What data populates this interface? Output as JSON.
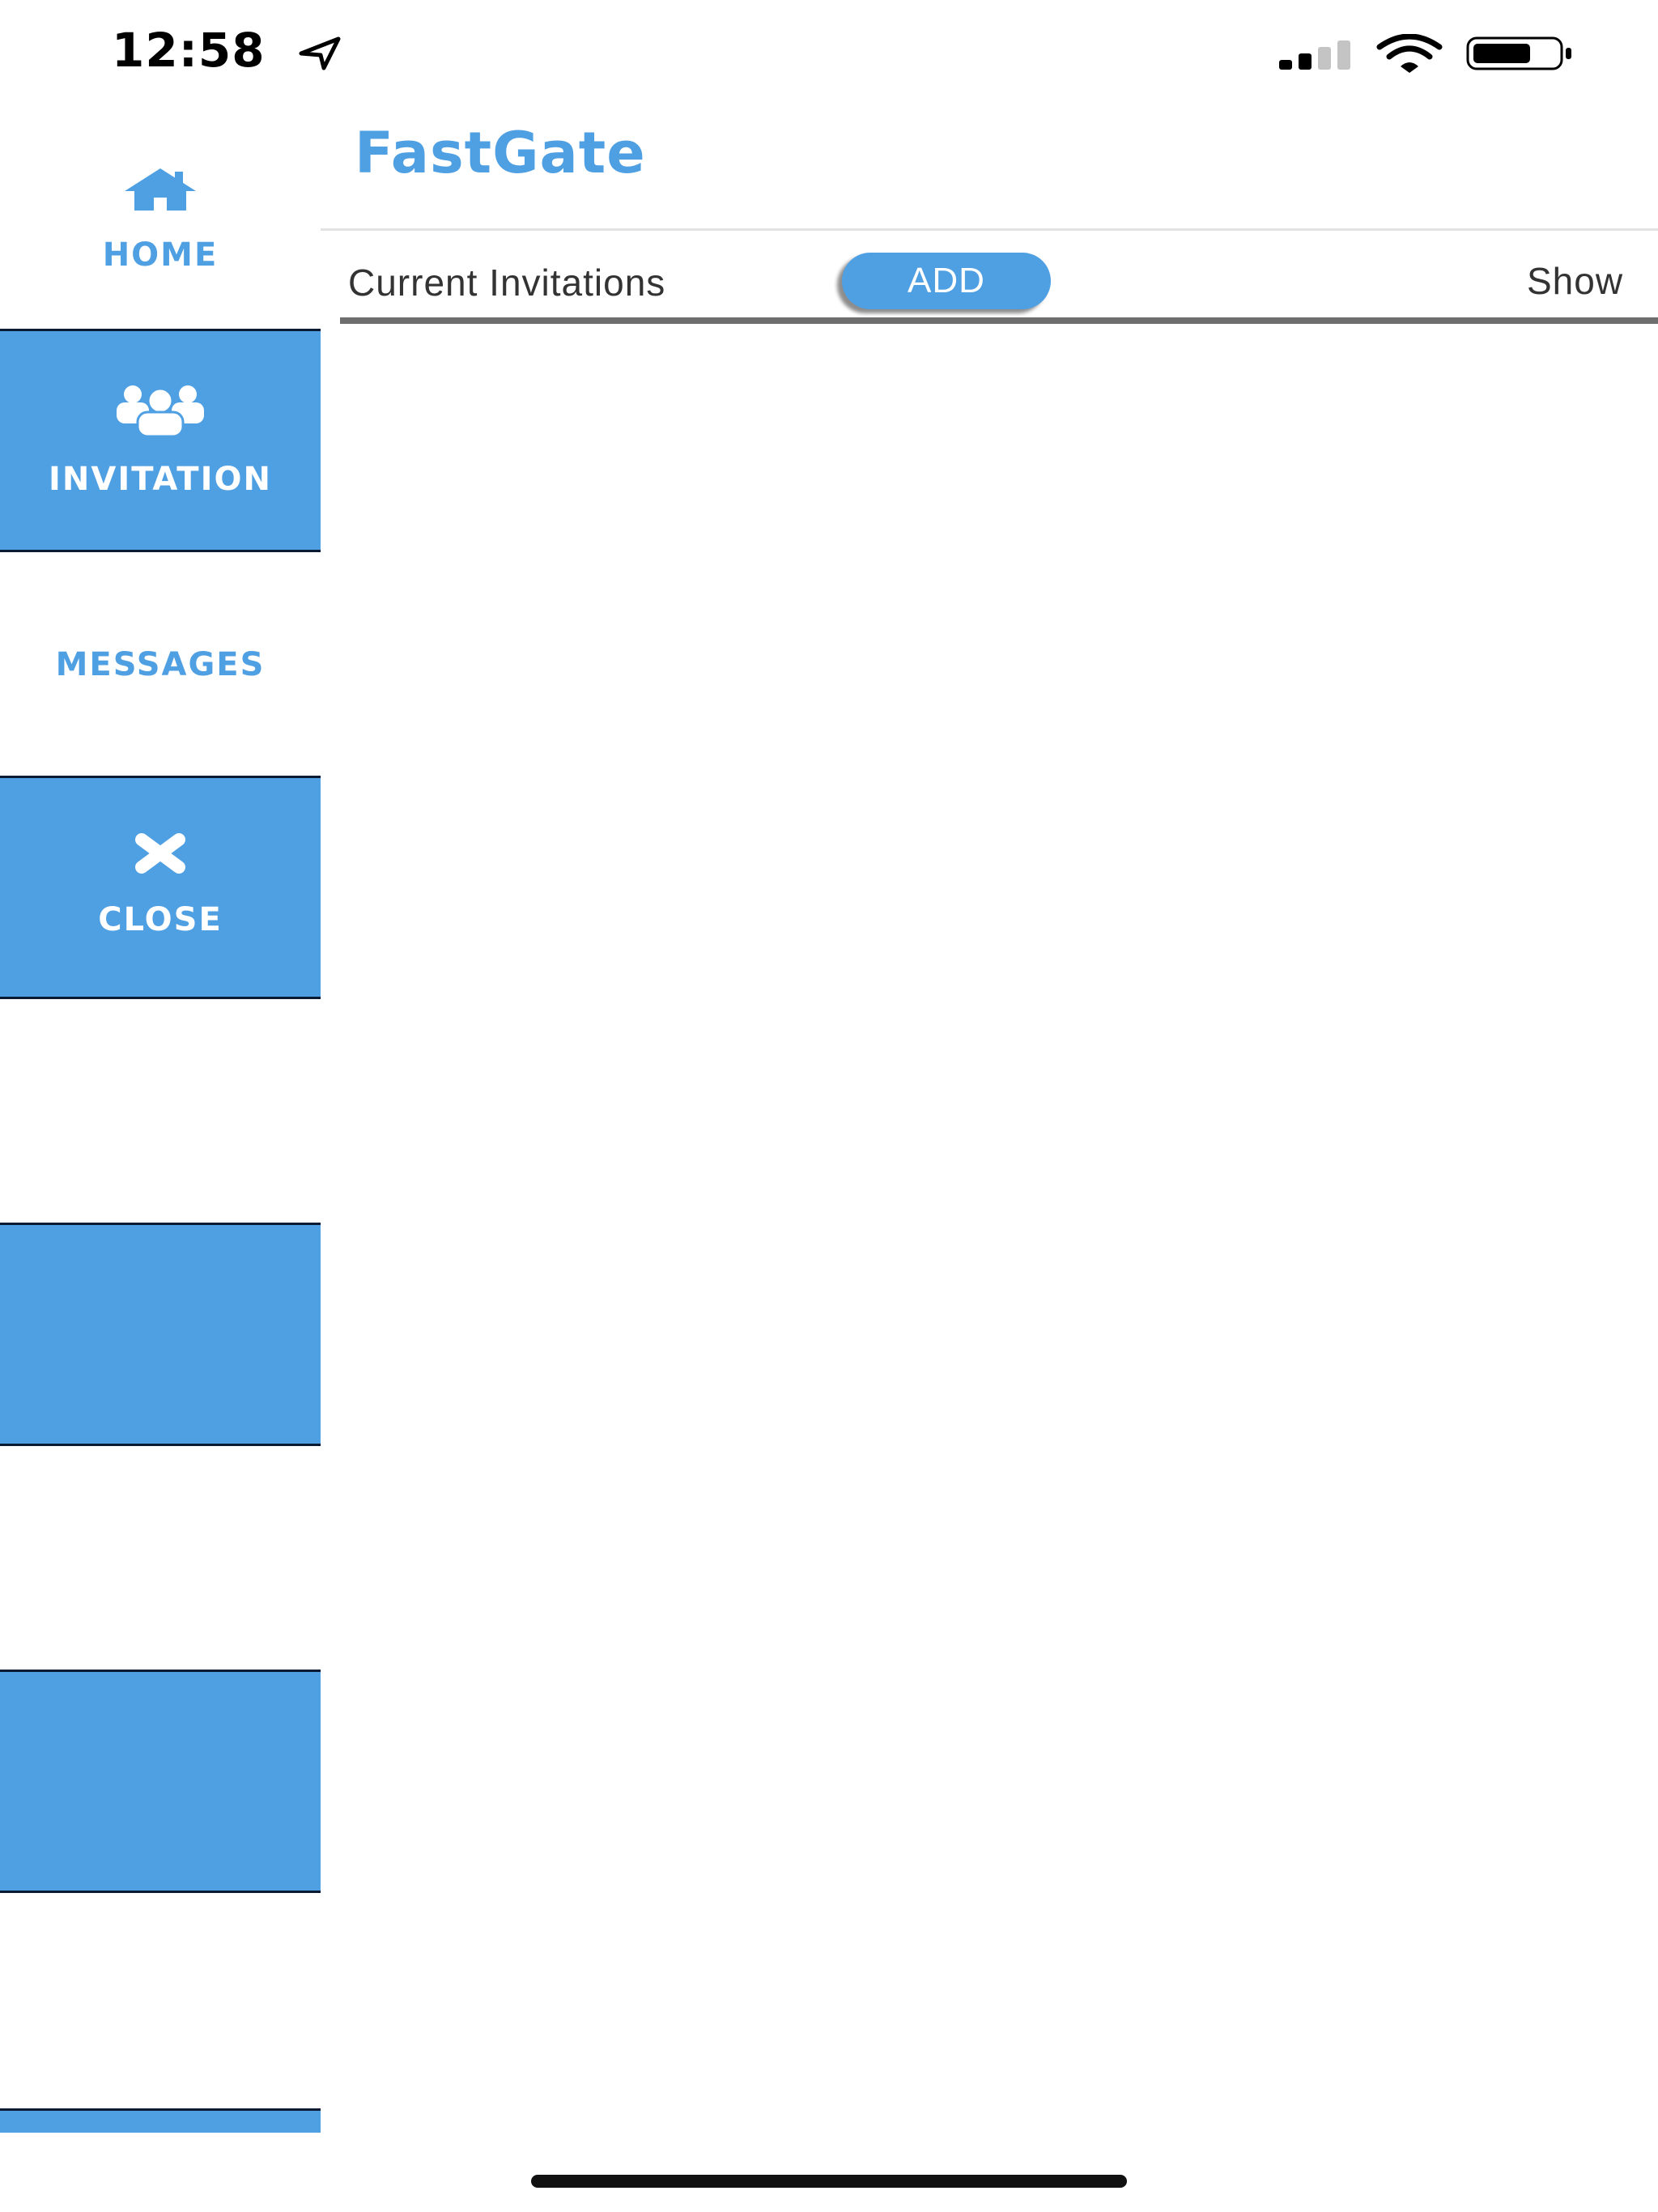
{
  "status_bar": {
    "time": "12:58",
    "icons": [
      "location-arrow-icon",
      "cellular-signal-icon",
      "wifi-icon",
      "battery-icon"
    ]
  },
  "app": {
    "title": "FastGate"
  },
  "sidebar": {
    "items": [
      {
        "label": "HOME",
        "icon": "home-icon",
        "style": "white"
      },
      {
        "label": "INVITATION",
        "icon": "users-icon",
        "style": "blue"
      },
      {
        "label": "MESSAGES",
        "icon": "",
        "style": "white"
      },
      {
        "label": "CLOSE",
        "icon": "close-icon",
        "style": "blue"
      },
      {
        "label": "",
        "icon": "",
        "style": "white"
      },
      {
        "label": "",
        "icon": "",
        "style": "blue"
      },
      {
        "label": "",
        "icon": "",
        "style": "white"
      },
      {
        "label": "",
        "icon": "",
        "style": "blue"
      },
      {
        "label": "",
        "icon": "",
        "style": "white"
      },
      {
        "label": "",
        "icon": "",
        "style": "blue"
      }
    ]
  },
  "toolbar": {
    "section_label": "Current Invitations",
    "add_label": "ADD",
    "show_label": "Show"
  },
  "colors": {
    "accent": "#4f9fe3",
    "divider": "#6e6e6e",
    "text": "#333333"
  }
}
